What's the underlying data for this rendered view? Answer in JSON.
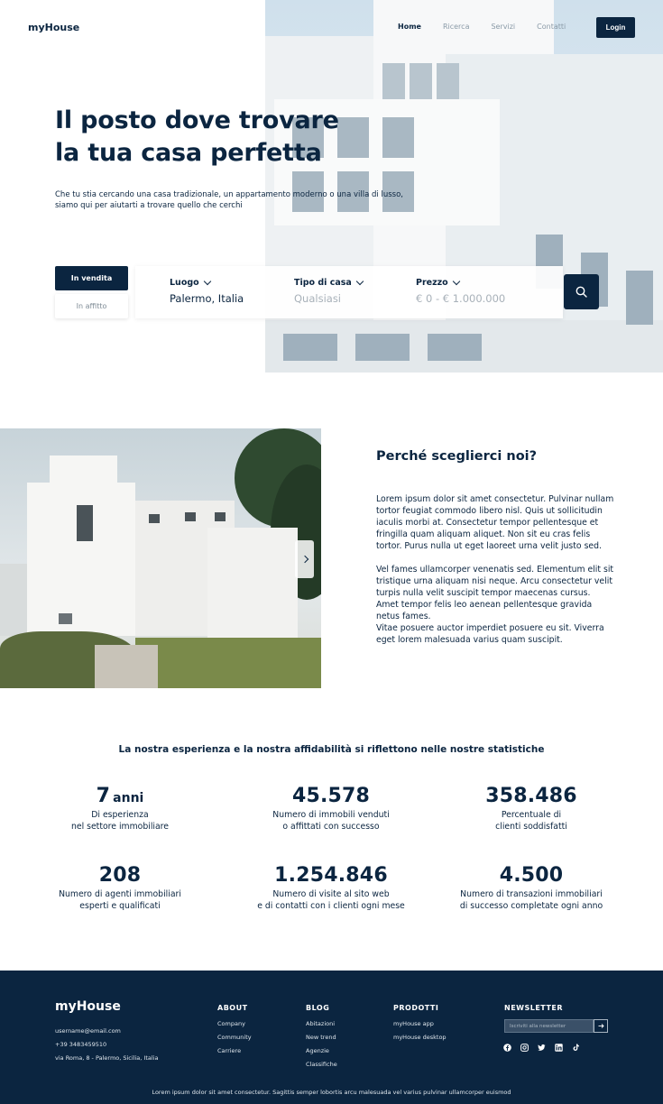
{
  "header": {
    "logo": "myHouse",
    "nav": [
      {
        "label": "Home",
        "active": true
      },
      {
        "label": "Ricerca",
        "active": false
      },
      {
        "label": "Servizi",
        "active": false
      },
      {
        "label": "Contatti",
        "active": false
      }
    ],
    "login_label": "Login"
  },
  "hero": {
    "title_line1": "Il posto dove trovare",
    "title_line2": "la tua casa perfetta",
    "subtitle_line1": "Che tu stia cercando una casa tradizionale, un appartamento moderno o una villa di lusso,",
    "subtitle_line2": "siamo qui per aiutarti a trovare quello che cerchi",
    "tabs": [
      {
        "label": "In vendita",
        "active": true
      },
      {
        "label": "In affitto",
        "active": false
      }
    ],
    "search": {
      "location": {
        "label": "Luogo",
        "value": "Palermo, Italia"
      },
      "type": {
        "label": "Tipo di casa",
        "value": "Qualsiasi"
      },
      "price": {
        "label": "Prezzo",
        "value": "€ 0 - € 1.000.000"
      },
      "button_icon": "search-icon"
    }
  },
  "why": {
    "title": "Perché sceglierci noi?",
    "paragraph1": "Lorem ipsum dolor sit amet consectetur. Pulvinar nullam tortor feugiat commodo libero nisl. Quis ut sollicitudin iaculis morbi at. Consectetur tempor pellentesque et fringilla quam aliquam aliquet. Non sit eu cras felis tortor. Purus nulla ut eget laoreet urna velit justo sed.",
    "paragraph2": "Vel fames ullamcorper venenatis sed. Elementum elit sit tristique urna aliquam nisi neque. Arcu consectetur velit turpis nulla velit suscipit tempor maecenas cursus. Amet tempor felis leo aenean pellentesque gravida netus fames.",
    "paragraph3": "Vitae posuere auctor imperdiet posuere eu sit. Viverra eget lorem malesuada varius quam suscipit.",
    "slider_icon": "chevron-right-icon"
  },
  "stats": {
    "title": "La nostra esperienza e la nostra affidabilità si riflettono nelle nostre statistiche",
    "items": [
      {
        "value": "7",
        "unit": "anni",
        "desc1": "Di esperienza",
        "desc2": "nel settore immobiliare"
      },
      {
        "value": "45.578",
        "unit": "",
        "desc1": "Numero di immobili venduti",
        "desc2": "o affittati con successo"
      },
      {
        "value": "358.486",
        "unit": "",
        "desc1": "Percentuale di",
        "desc2": "clienti soddisfatti"
      },
      {
        "value": "208",
        "unit": "",
        "desc1": "Numero di agenti immobiliari",
        "desc2": "esperti e qualificati"
      },
      {
        "value": "1.254.846",
        "unit": "",
        "desc1": "Numero di visite al sito web",
        "desc2": "e di contatti con i clienti ogni mese"
      },
      {
        "value": "4.500",
        "unit": "",
        "desc1": "Numero di transazioni immobiliari",
        "desc2": "di successo completate ogni anno"
      }
    ]
  },
  "footer": {
    "logo": "myHouse",
    "email": "username@email.com",
    "phone": "+39 3483459510",
    "address": "via Roma, 8 - Palermo, Sicilia, Italia",
    "about": {
      "heading": "ABOUT",
      "items": [
        "Company",
        "Community",
        "Carriere"
      ]
    },
    "blog": {
      "heading": "BLOG",
      "items": [
        "Abitazioni",
        "New trend",
        "Agenzie",
        "Classifiche"
      ]
    },
    "products": {
      "heading": "PRODOTTI",
      "items": [
        "myHouse app",
        "myHouse desktop"
      ]
    },
    "newsletter": {
      "heading": "NEWSLETTER",
      "placeholder": "Iscriviti alla newsletter"
    },
    "socials": [
      "facebook-icon",
      "instagram-icon",
      "twitter-icon",
      "linkedin-icon",
      "tiktok-icon"
    ],
    "bottom_text": "Lorem ipsum dolor sit amet consectetur. Sagittis semper lobortis arcu malesuada vel varius pulvinar ullamcorper euismod"
  }
}
